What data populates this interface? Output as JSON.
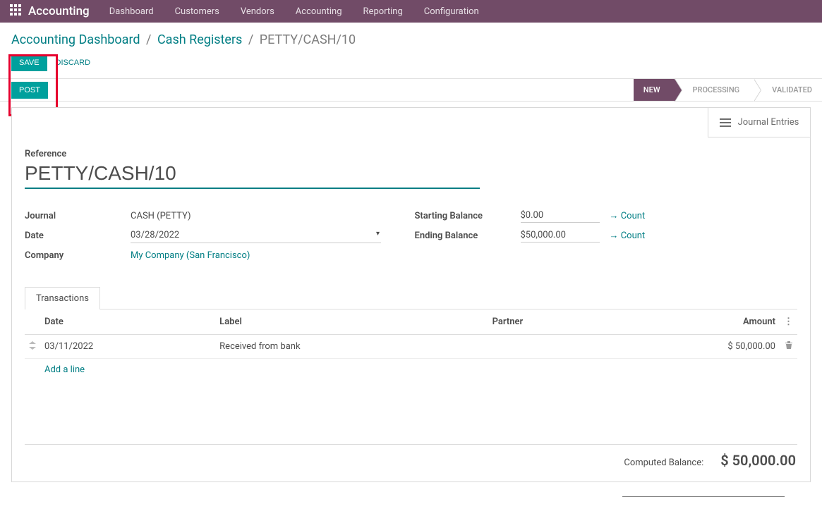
{
  "navbar": {
    "brand": "Accounting",
    "items": [
      "Dashboard",
      "Customers",
      "Vendors",
      "Accounting",
      "Reporting",
      "Configuration"
    ]
  },
  "breadcrumb": {
    "item1": "Accounting Dashboard",
    "item2": "Cash Registers",
    "current": "PETTY/CASH/10"
  },
  "actions": {
    "save": "SAVE",
    "discard": "DISCARD",
    "post": "POST"
  },
  "stages": [
    "NEW",
    "PROCESSING",
    "VALIDATED"
  ],
  "sheet": {
    "journal_entries": "Journal Entries",
    "reference_label": "Reference",
    "reference_value": "PETTY/CASH/10",
    "journal_label": "Journal",
    "journal_value": "CASH (PETTY)",
    "date_label": "Date",
    "date_value": "03/28/2022",
    "company_label": "Company",
    "company_value": "My Company (San Francisco)",
    "starting_balance_label": "Starting Balance",
    "starting_balance_value": "$0.00",
    "ending_balance_label": "Ending Balance",
    "ending_balance_value": "$50,000.00",
    "count_link": "→ Count"
  },
  "tabs": {
    "transactions": "Transactions"
  },
  "table": {
    "headers": {
      "date": "Date",
      "label": "Label",
      "partner": "Partner",
      "amount": "Amount"
    },
    "rows": [
      {
        "date": "03/11/2022",
        "label": "Received from bank",
        "partner": "",
        "amount": "$ 50,000.00"
      }
    ],
    "add_line": "Add a line"
  },
  "computed": {
    "label": "Computed Balance:",
    "value": "$ 50,000.00"
  }
}
